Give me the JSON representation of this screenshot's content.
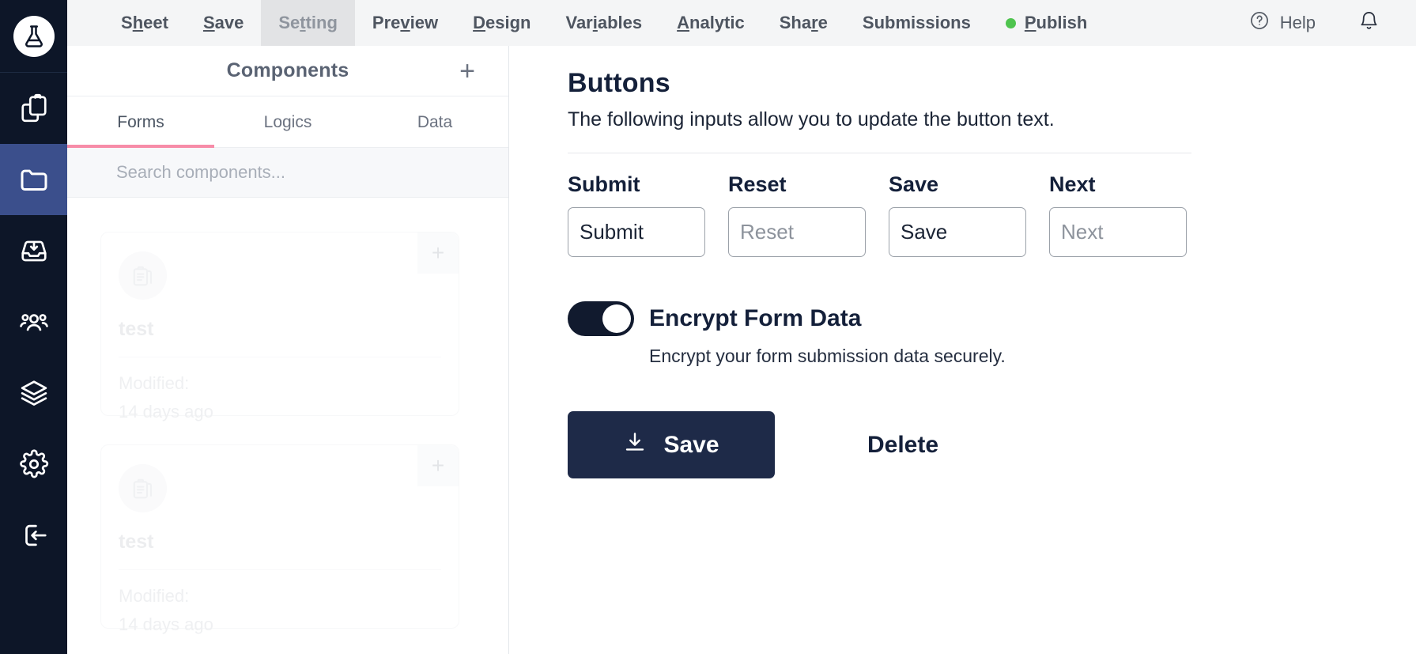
{
  "rail": {
    "logo_name": "flask-logo",
    "items": [
      {
        "icon": "clipboard-copy-icon",
        "name": "sidebar-item-clipboard",
        "active": false
      },
      {
        "icon": "folder-icon",
        "name": "sidebar-item-folder",
        "active": true
      },
      {
        "icon": "inbox-download-icon",
        "name": "sidebar-item-inbox",
        "active": false
      },
      {
        "icon": "users-icon",
        "name": "sidebar-item-users",
        "active": false
      },
      {
        "icon": "layers-icon",
        "name": "sidebar-item-layers",
        "active": false
      },
      {
        "icon": "gear-icon",
        "name": "sidebar-item-settings",
        "active": false
      },
      {
        "icon": "logout-icon",
        "name": "sidebar-item-logout",
        "active": false
      }
    ]
  },
  "topbar": {
    "nav": [
      {
        "label": "Sheet",
        "accel": "h",
        "active": false
      },
      {
        "label": "Save",
        "accel": "S",
        "active": false
      },
      {
        "label": "Setting",
        "accel": "t",
        "active": true
      },
      {
        "label": "Preview",
        "accel": "v",
        "active": false
      },
      {
        "label": "Design",
        "accel": "D",
        "active": false
      },
      {
        "label": "Variables",
        "accel": "i",
        "active": false
      },
      {
        "label": "Analytic",
        "accel": "A",
        "active": false
      },
      {
        "label": "Share",
        "accel": "r",
        "active": false
      },
      {
        "label": "Submissions",
        "accel": "",
        "active": false
      },
      {
        "label": "Publish",
        "accel": "P",
        "active": false,
        "dot": true,
        "dot_color": "#4ec44e"
      }
    ],
    "help_label": "Help",
    "help_icon": "question-circle-icon",
    "bell_icon": "bell-icon"
  },
  "panel": {
    "title": "Components",
    "add_label": "+",
    "tabs": [
      {
        "label": "Forms",
        "active": true
      },
      {
        "label": "Logics",
        "active": false
      },
      {
        "label": "Data",
        "active": false
      }
    ],
    "search_placeholder": "Search components...",
    "search_value": "",
    "cards": [
      {
        "name": "test",
        "meta_label": "Modified:",
        "meta_value": "14 days ago",
        "icon": "clipboard-list-icon",
        "add_label": "+"
      },
      {
        "name": "test",
        "meta_label": "Modified:",
        "meta_value": "14 days ago",
        "icon": "clipboard-list-icon",
        "add_label": "+"
      }
    ]
  },
  "main": {
    "title": "Buttons",
    "description": "The following inputs allow you to update the button text.",
    "fields": [
      {
        "label": "Submit",
        "value": "Submit",
        "placeholder": "Submit",
        "filled": true
      },
      {
        "label": "Reset",
        "value": "",
        "placeholder": "Reset",
        "filled": false
      },
      {
        "label": "Save",
        "value": "Save",
        "placeholder": "Save",
        "filled": true
      },
      {
        "label": "Next",
        "value": "",
        "placeholder": "Next",
        "filled": false
      }
    ],
    "toggle": {
      "label": "Encrypt Form Data",
      "help": "Encrypt your form submission data securely.",
      "on": true,
      "on_color": "#111a2e"
    },
    "save_button": {
      "label": "Save",
      "icon": "download-icon",
      "color": "#1e2a48"
    },
    "delete_button": {
      "label": "Delete"
    }
  }
}
